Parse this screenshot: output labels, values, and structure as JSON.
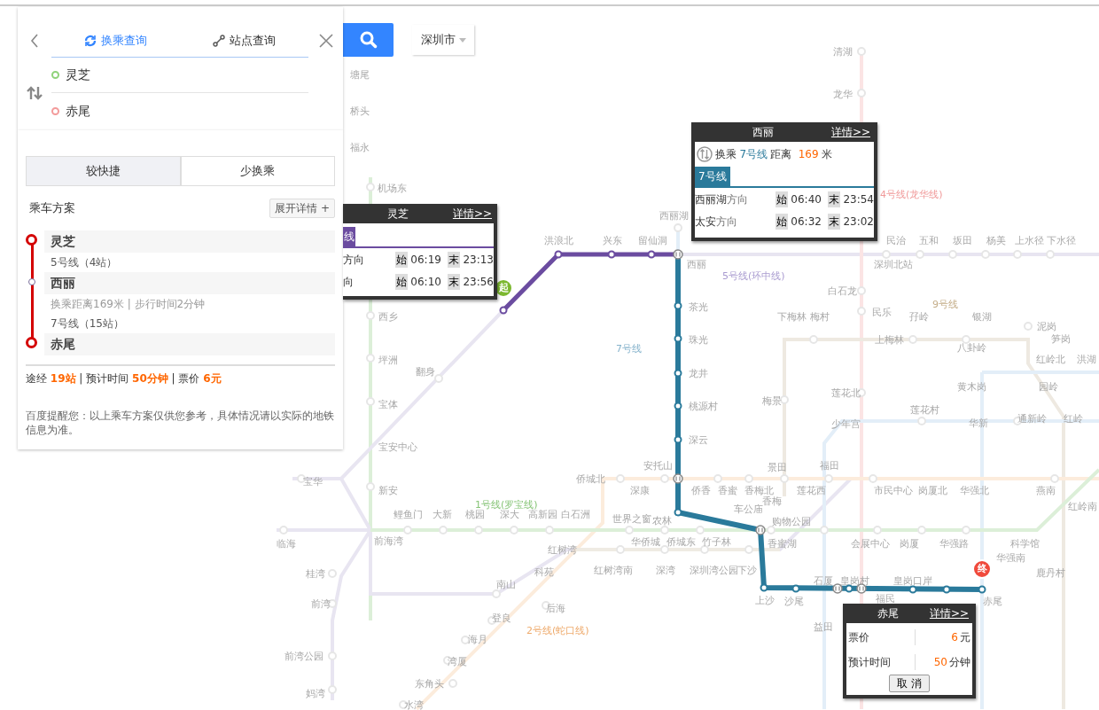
{
  "search": {
    "city": "深圳市"
  },
  "query_panel": {
    "tabs": [
      {
        "label": "换乘查询",
        "selected": true
      },
      {
        "label": "站点查询",
        "selected": false
      }
    ],
    "start": "灵芝",
    "end": "赤尾"
  },
  "plan_panel": {
    "options": [
      {
        "label": "较快捷",
        "selected": true
      },
      {
        "label": "少换乘",
        "selected": false
      }
    ],
    "title": "乘车方案",
    "expand_button": "展开详情 +",
    "steps": [
      {
        "kind": "station",
        "name": "灵芝",
        "endpoint": true
      },
      {
        "kind": "line",
        "text": "5号线（4站）"
      },
      {
        "kind": "station",
        "name": "西丽",
        "endpoint": false
      },
      {
        "kind": "transfer",
        "text": "换乘距离169米 | 步行时间2分钟"
      },
      {
        "kind": "line",
        "text": "7号线（15站）"
      },
      {
        "kind": "station",
        "name": "赤尾",
        "endpoint": true
      }
    ],
    "summary": "途经 **19站** | 预计时间 **50分钟** | 票价 **6元**",
    "notice": "百度提醒您：以上乘车方案仅供您参考，具体情况请以实际的地铁信息为准。"
  },
  "start_popup": {
    "station": "灵芝",
    "details_link": "详情>>",
    "line_tag": "线",
    "rows": [
      {
        "direction": "方向",
        "first_label": "始",
        "first": "06:19",
        "last_label": "末",
        "last": "23:13"
      },
      {
        "direction": "向",
        "first_label": "始",
        "first": "06:10",
        "last_label": "末",
        "last": "23:56"
      }
    ]
  },
  "transfer_popup": {
    "station": "西丽",
    "details_link": "详情>>",
    "transfer_label": "换乘",
    "line": "7号线",
    "distance_label": "距离",
    "distance": "169",
    "unit": "米",
    "line_tag": "7号线",
    "rows": [
      {
        "terminal": "西丽湖",
        "direction": "方向",
        "first_label": "始",
        "first": "06:40",
        "last_label": "末",
        "last": "23:54"
      },
      {
        "terminal": "太安",
        "direction": "方向",
        "first_label": "始",
        "first": "06:32",
        "last_label": "末",
        "last": "23:02"
      }
    ]
  },
  "end_popup": {
    "station": "赤尾",
    "details_link": "详情>>",
    "rows": [
      {
        "label": "票价",
        "value": "6",
        "unit": "元"
      },
      {
        "label": "预计时间",
        "value": "50",
        "unit": "分钟"
      }
    ],
    "cancel_button": "取 消"
  },
  "markers": {
    "start": "起",
    "end": "终"
  },
  "line_labels": [
    {
      "text": "4号线(龙华线)",
      "color": "#f09a9a"
    },
    {
      "text": "5号线(环中线)",
      "color": "#a99bd0"
    },
    {
      "text": "9号线",
      "color": "#c4ad88"
    },
    {
      "text": "7号线",
      "color": "#86b3cc"
    },
    {
      "text": "1号线(罗宝线)",
      "color": "#86c476"
    },
    {
      "text": "2号线(蛇口线)",
      "color": "#eeaa6c"
    }
  ],
  "station_labels": [
    "塘尾",
    "桥头",
    "福永",
    "机场东",
    "清湖",
    "龙华",
    "西丽湖",
    "洪浪北",
    "兴东",
    "留仙洞",
    "西丽",
    "民治",
    "五和",
    "坂田",
    "杨美",
    "上水径",
    "下水径",
    "深圳北站",
    "白石龙",
    "民乐",
    "下梅林",
    "梅村",
    "孖岭",
    "银湖",
    "泥岗",
    "上梅林",
    "笋岗",
    "八卦岭",
    "红岭北",
    "洪湖",
    "茶光",
    "珠光",
    "龙井",
    "桃源村",
    "深云",
    "西乡",
    "坪洲",
    "翻身",
    "宝体",
    "宝安中心",
    "新安",
    "梅景",
    "莲花北",
    "黄木岗",
    "园岭",
    "少年宫",
    "莲花村",
    "华新",
    "通新岭",
    "红岭",
    "安托山",
    "侨城北",
    "景田",
    "福田",
    "深康",
    "侨香",
    "香蜜",
    "香梅北",
    "莲花西",
    "市民中心",
    "岗厦北",
    "华强北",
    "燕南",
    "宝华",
    "香梅",
    "红岭南",
    "鲤鱼门",
    "大新",
    "桃园",
    "深大",
    "高新园",
    "白石洲",
    "世界之窗",
    "农林",
    "车公庙",
    "购物公园",
    "临海",
    "前海湾",
    "华侨城",
    "侨城东",
    "竹子林",
    "香蜜湖",
    "会展中心",
    "岗厦",
    "华强路",
    "科学馆",
    "红树湾",
    "华强南",
    "桂湾",
    "科苑",
    "红树湾南",
    "深湾",
    "深圳湾公园",
    "下沙",
    "鹿丹村",
    "南山",
    "石厦",
    "皇岗村",
    "皇岗口岸",
    "前湾",
    "后海",
    "上沙",
    "沙尾",
    "福民",
    "赤尾",
    "登良",
    "益田",
    "海月",
    "前湾公园",
    "湾厦",
    "东角头",
    "妈湾",
    "水湾"
  ]
}
